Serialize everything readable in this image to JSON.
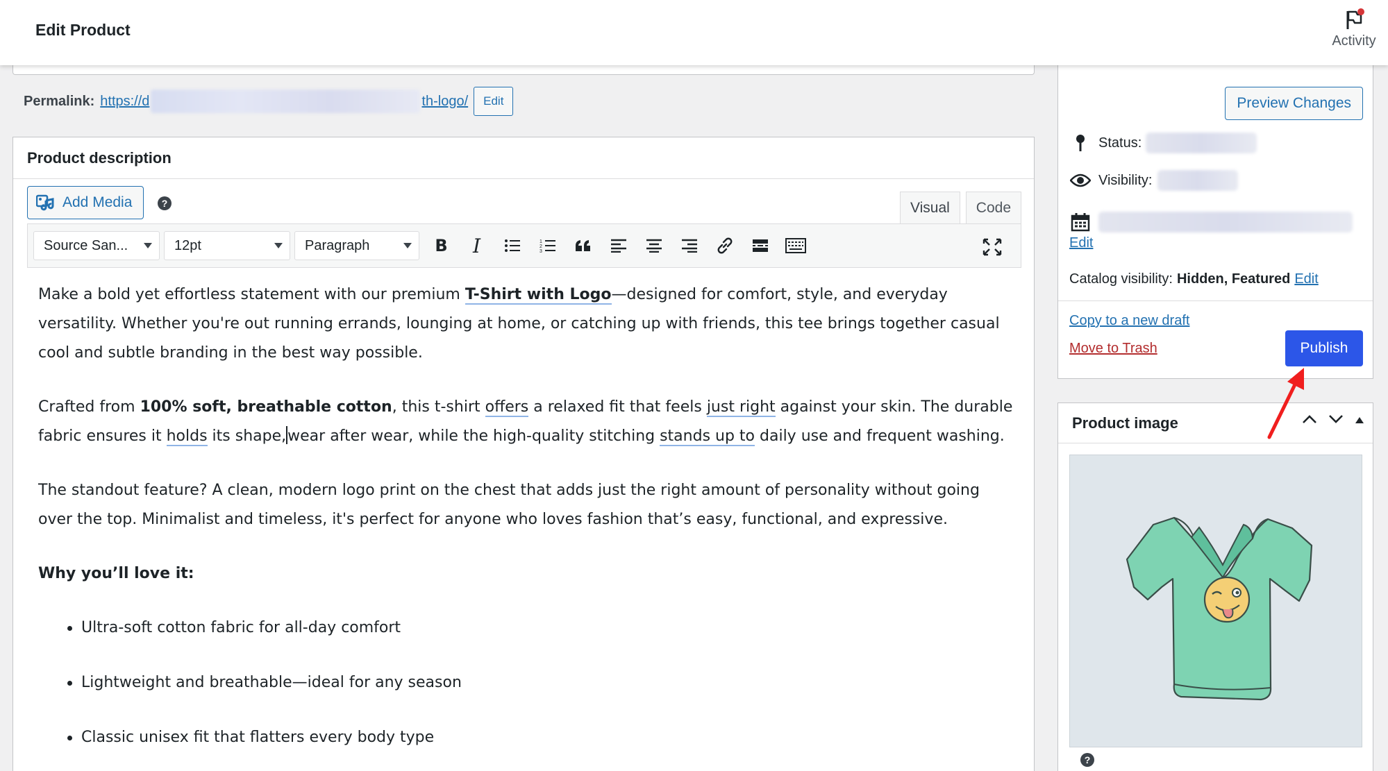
{
  "header": {
    "title": "Edit Product",
    "activity_label": "Activity"
  },
  "permalink": {
    "label": "Permalink:",
    "url_start": "https://d",
    "url_end": "th-logo/",
    "edit_label": "Edit"
  },
  "editor": {
    "box_title": "Product description",
    "add_media_label": "Add Media",
    "tabs": {
      "visual": "Visual",
      "code": "Code"
    },
    "toolbar": {
      "font_family": "Source San...",
      "font_size": "12pt",
      "block_format": "Paragraph"
    },
    "content": {
      "p1": {
        "a": "Make a bold yet effortless statement with our premium ",
        "b": "T-Shirt with Logo",
        "c": "—designed for comfort, style, and everyday versatility. Whether you're out running errands, lounging at home, or catching up with friends, this tee brings together casual cool and subtle branding in the best way possible."
      },
      "p2": {
        "a": "Crafted from ",
        "b": "100% soft, breathable cotton",
        "c": ", this t-shirt ",
        "d": "offers",
        "e": " a relaxed fit that feels ",
        "f": "just right",
        "g": " against your skin. The durable fabric ensures it ",
        "h": "holds",
        "i": " its shape,",
        "j": "wear after wear, while the high-quality stitching ",
        "k": "stands up to",
        "l": " daily use and frequent washing."
      },
      "p3": "The standout feature? A clean, modern logo print on the chest that adds just the right amount of personality without going over the top. Minimalist and timeless, it's perfect for anyone who loves fashion that’s easy, functional, and expressive.",
      "why_heading": "Why you’ll love it:",
      "bullets": [
        "Ultra-soft cotton fabric for all-day comfort",
        "Lightweight and breathable—ideal for any season",
        "Classic unisex fit that flatters every body type"
      ]
    }
  },
  "publish_box": {
    "preview_label": "Preview Changes",
    "status_label": "Status:",
    "visibility_label": "Visibility:",
    "date_edit_label": "Edit",
    "catalog_label": "Catalog visibility:",
    "catalog_value": "Hidden, Featured",
    "catalog_edit_label": "Edit",
    "copy_draft_label": "Copy to a new draft",
    "trash_label": "Move to Trash",
    "publish_label": "Publish"
  },
  "product_image_box": {
    "title": "Product image"
  },
  "colors": {
    "accent": "#2271b1",
    "publish": "#2c56e8",
    "trash": "#b32d2e",
    "annotation": "#f01e1e",
    "tshirt": "#7ed3b2"
  }
}
